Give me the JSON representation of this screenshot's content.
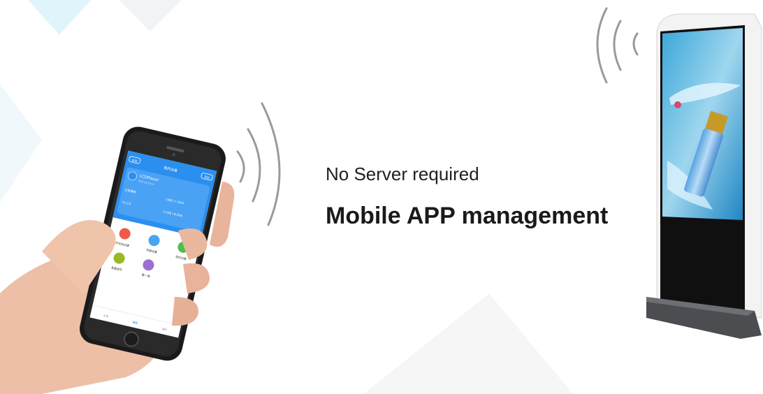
{
  "headline": {
    "subtitle": "No Server required",
    "title": "Mobile APP management"
  },
  "phone_app": {
    "header_left_button": "返回",
    "header_title": "我的设备",
    "header_right_button": "添加",
    "device_card": {
      "device_name": "LCDPlayer",
      "device_id": "ID:0 10.0.0.0",
      "status": "正常播放",
      "resolution": "1080 × 1920",
      "storage": "2.1GB / 8.0GB",
      "version": "V1.0.0"
    },
    "functions": [
      {
        "label": "开关机设置",
        "color": "#f05a4a"
      },
      {
        "label": "亮度设置",
        "color": "#45a6ee"
      },
      {
        "label": "定时设置",
        "color": "#4fbf4b"
      },
      {
        "label": "音量调节",
        "color": "#9ab923"
      },
      {
        "label": "截一屏",
        "color": "#9a6fd1"
      }
    ],
    "tabs": [
      "设备",
      "播放",
      "我的"
    ]
  },
  "colors": {
    "app_blue": "#2b8ff0",
    "signal_waves": "#9a9a9a",
    "kiosk_frame": "#f4f4f4",
    "kiosk_base": "#4b4d50"
  },
  "icons": [
    "wifi-signal-icon",
    "power-icon",
    "brightness-icon",
    "timer-icon",
    "volume-icon",
    "screenshot-icon"
  ]
}
